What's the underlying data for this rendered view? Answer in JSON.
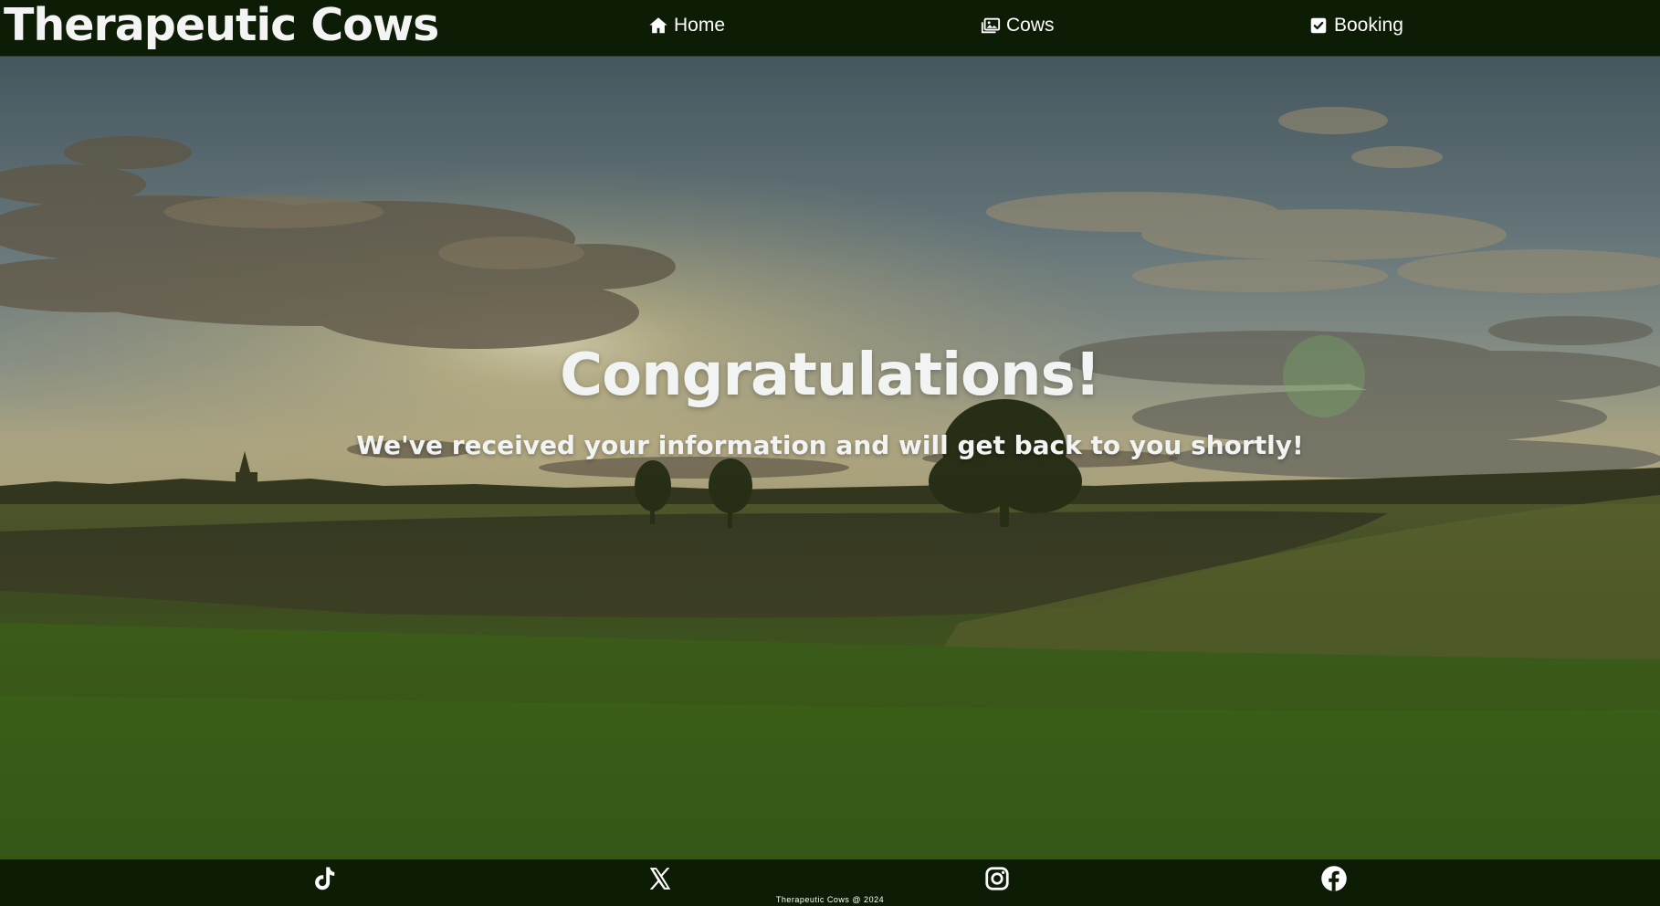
{
  "header": {
    "brand": "Therapeutic Cows",
    "nav": [
      {
        "label": "Home",
        "icon": "home-icon"
      },
      {
        "label": "Cows",
        "icon": "images-icon"
      },
      {
        "label": "Booking",
        "icon": "check-square-icon"
      }
    ]
  },
  "hero": {
    "background": "hero-meadow-sunset-photo",
    "headline": "Congratulations!",
    "message": "We've received your information and will get back to you shortly!"
  },
  "footer": {
    "social": [
      {
        "name": "TikTok",
        "icon": "tiktok-icon"
      },
      {
        "name": "X",
        "icon": "x-icon"
      },
      {
        "name": "Instagram",
        "icon": "instagram-icon"
      },
      {
        "name": "Facebook",
        "icon": "facebook-icon"
      }
    ],
    "copyright": "Therapeutic Cows @ 2024"
  },
  "colors": {
    "bar_background": "#0d1c04",
    "text": "#ffffff"
  }
}
